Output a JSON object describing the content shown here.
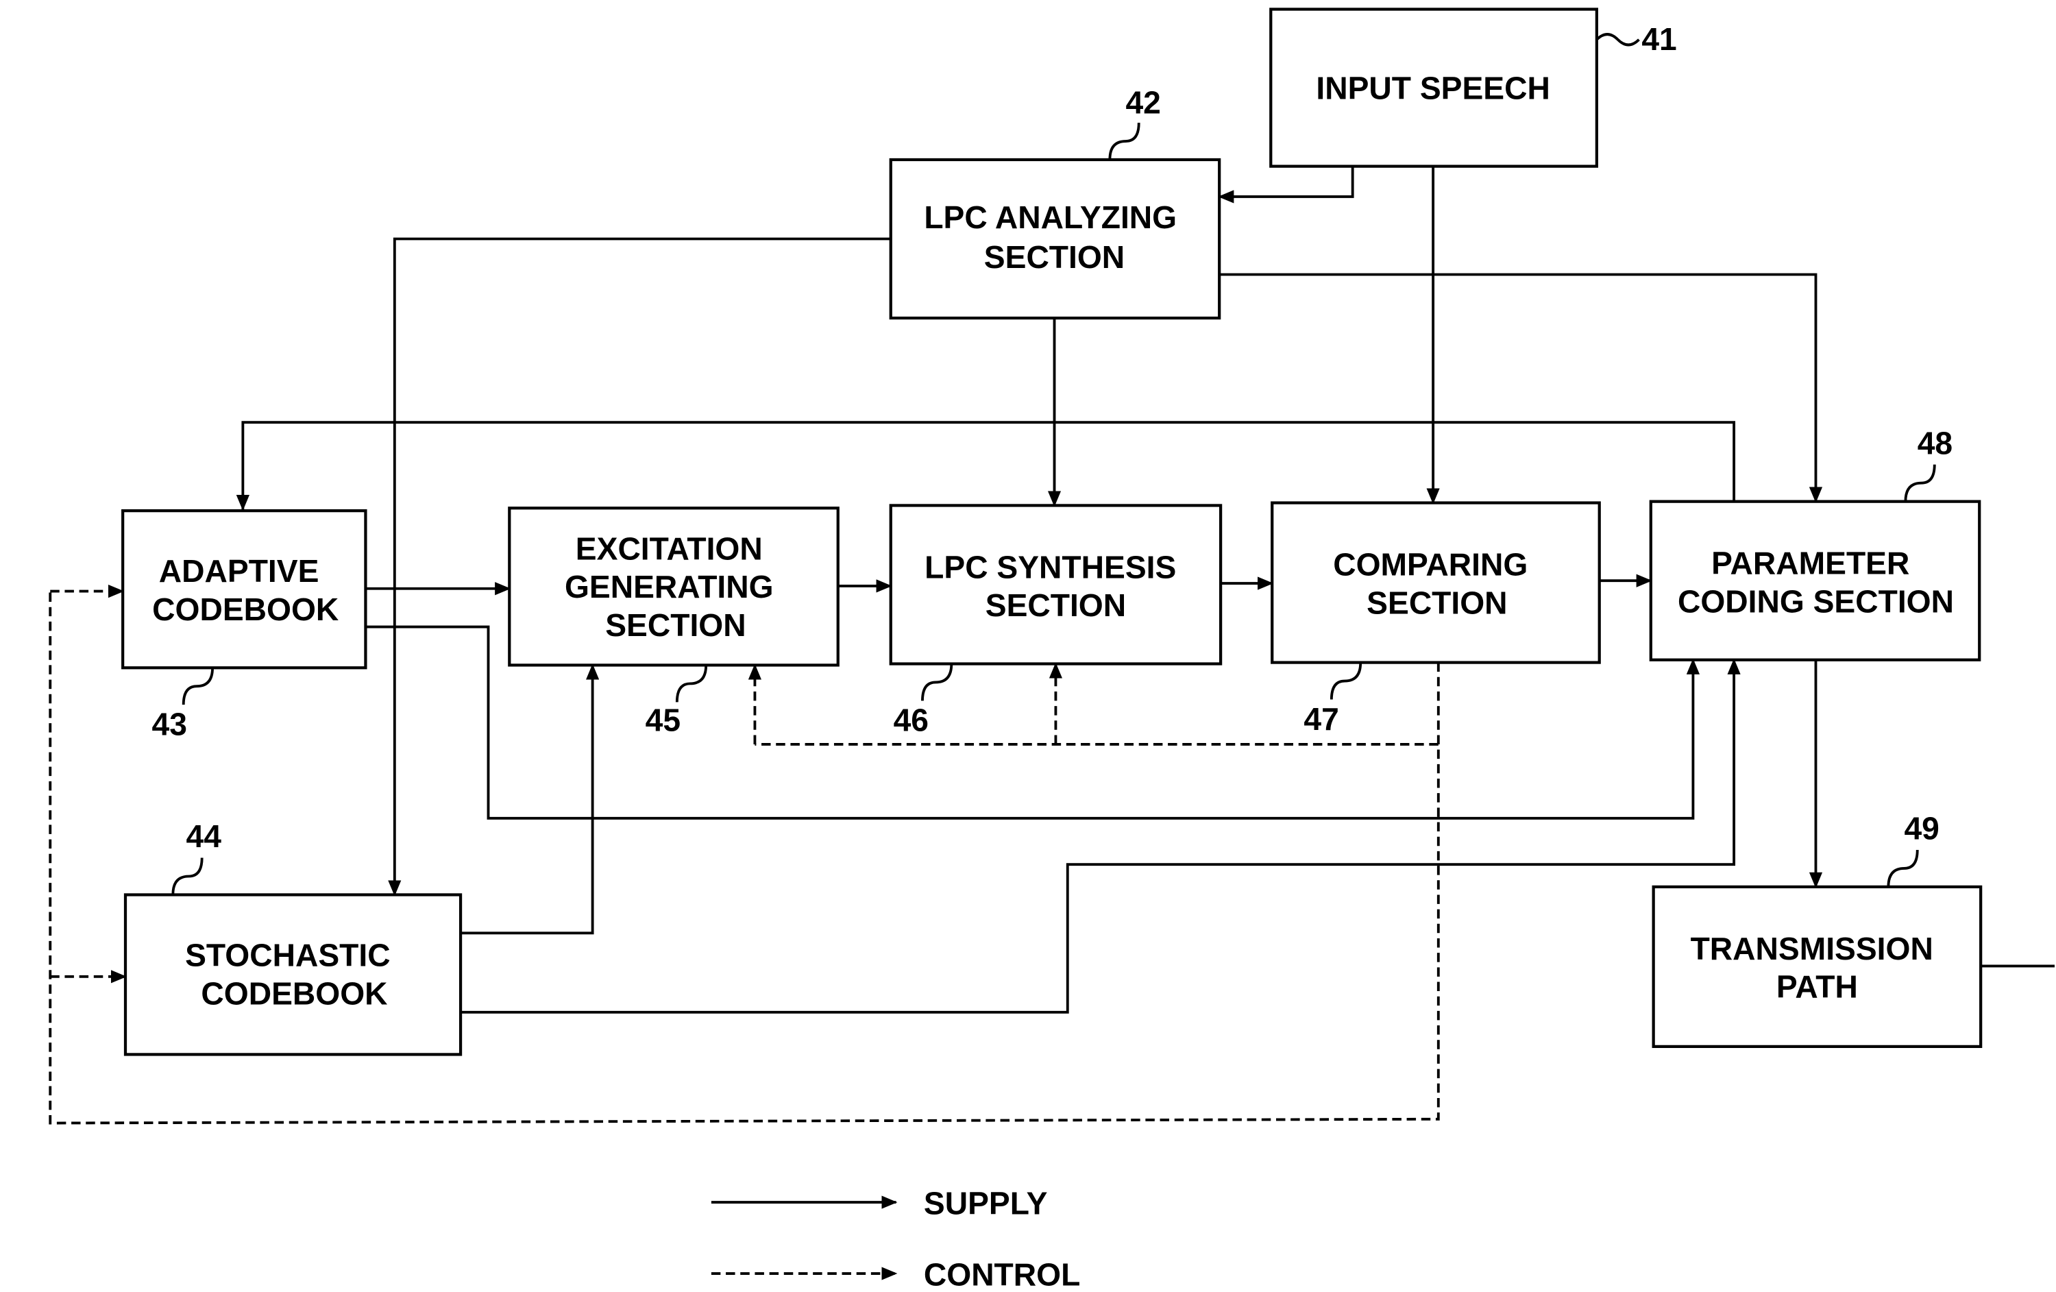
{
  "blocks": {
    "input_speech": {
      "lines": [
        "INPUT SPEECH"
      ],
      "ref": "41"
    },
    "lpc_analyzing": {
      "lines": [
        "LPC ANALYZING",
        "SECTION"
      ],
      "ref": "42"
    },
    "adaptive_codebook": {
      "lines": [
        "ADAPTIVE",
        "CODEBOOK"
      ],
      "ref": "43"
    },
    "stochastic_codebook": {
      "lines": [
        "STOCHASTIC",
        "CODEBOOK"
      ],
      "ref": "44"
    },
    "excitation_generating": {
      "lines": [
        "EXCITATION",
        "GENERATING",
        "SECTION"
      ],
      "ref": "45"
    },
    "lpc_synthesis": {
      "lines": [
        "LPC SYNTHESIS",
        "SECTION"
      ],
      "ref": "46"
    },
    "comparing": {
      "lines": [
        "COMPARING",
        "SECTION"
      ],
      "ref": "47"
    },
    "parameter_coding": {
      "lines": [
        "PARAMETER",
        "CODING SECTION"
      ],
      "ref": "48"
    },
    "transmission_path": {
      "lines": [
        "TRANSMISSION",
        "PATH"
      ],
      "ref": "49"
    }
  },
  "legend": {
    "supply": "SUPPLY",
    "control": "CONTROL"
  }
}
